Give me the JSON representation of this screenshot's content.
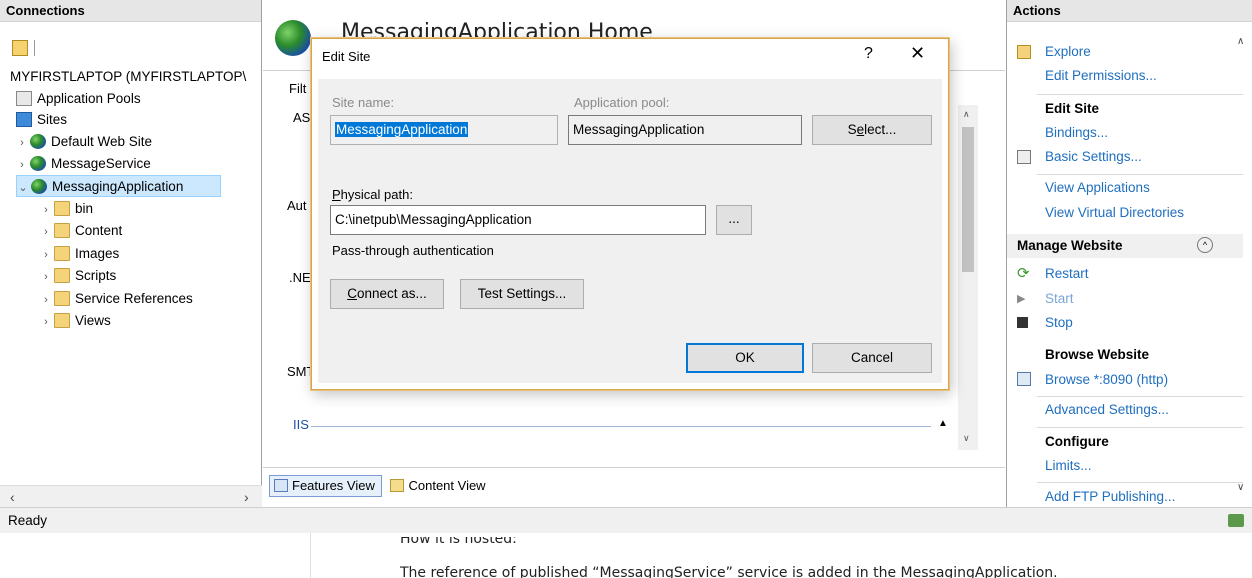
{
  "connections": {
    "title": "Connections",
    "server": "MYFIRSTLAPTOP (MYFIRSTLAPTOP\\",
    "app_pools": "Application Pools",
    "sites": "Sites",
    "site_items": [
      "Default Web Site",
      "MessageService",
      "MessagingApplication"
    ],
    "folders": [
      "bin",
      "Content",
      "Images",
      "Scripts",
      "Service References",
      "Views"
    ]
  },
  "center": {
    "home_title": "MessagingApplication Home",
    "cut_labels": {
      "filt": "Filt",
      "as": "AS",
      "aut": "Aut",
      "ne": ".NE",
      "smt": "SMT",
      "iis": "IIS"
    },
    "features_view": "Features View",
    "content_view": "Content View"
  },
  "dialog": {
    "title": "Edit Site",
    "help": "?",
    "close": "✕",
    "site_name_label": "Site name:",
    "site_name_value": "MessagingApplication",
    "app_pool_label": "Application pool:",
    "app_pool_value": "MessagingApplication",
    "select_pre": "S",
    "select_u": "e",
    "select_post": "lect...",
    "physical_path_pre": "",
    "physical_path_u": "P",
    "physical_path_post": "hysical path:",
    "physical_path_value": "C:\\inetpub\\MessagingApplication",
    "browse_label": "...",
    "pass_through": "Pass-through authentication",
    "connect_as_u": "C",
    "connect_as_post": "onnect as...",
    "test_settings_pre": "Test Settin",
    "test_settings_u": "g",
    "test_settings_post": "s...",
    "ok": "OK",
    "cancel": "Cancel"
  },
  "actions": {
    "title": "Actions",
    "explore": "Explore",
    "edit_permissions": "Edit Permissions...",
    "edit_site": "Edit Site",
    "bindings": "Bindings...",
    "basic_settings": "Basic Settings...",
    "view_applications": "View Applications",
    "view_virtual_dirs": "View Virtual Directories",
    "manage_website": "Manage Website",
    "restart": "Restart",
    "start": "Start",
    "stop": "Stop",
    "browse_website": "Browse Website",
    "browse_port": "Browse *:8090 (http)",
    "advanced_settings": "Advanced Settings...",
    "configure": "Configure",
    "limits": "Limits...",
    "add_ftp": "Add FTP Publishing..."
  },
  "status": {
    "text": "Ready"
  },
  "document": {
    "line1": "How it is hosted:",
    "line2": "The reference of published “MessagingService” service is added in the MessagingApplication."
  },
  "colors": {
    "link": "#1f6fbf",
    "selection": "#0078d7",
    "dialog_border": "#d9a54a"
  }
}
